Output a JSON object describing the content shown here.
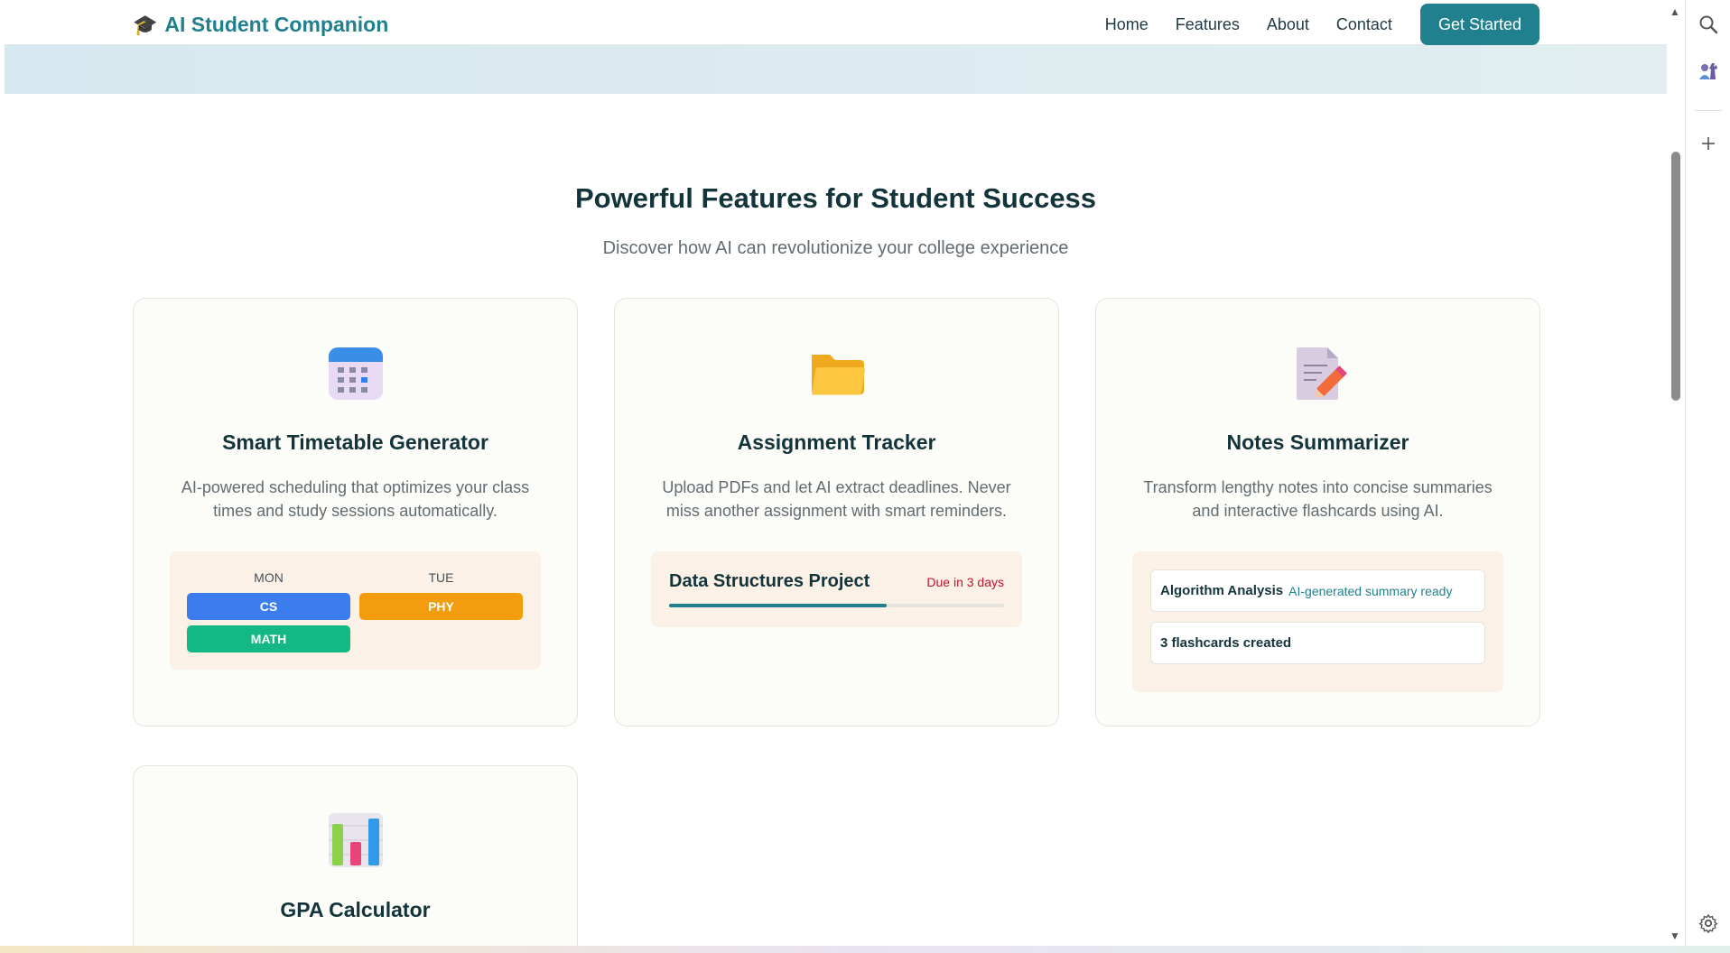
{
  "brand": {
    "icon": "🎓",
    "name": "AI Student Companion"
  },
  "nav": {
    "links": [
      "Home",
      "Features",
      "About",
      "Contact"
    ],
    "cta": "Get Started"
  },
  "section": {
    "title": "Powerful Features for Student Success",
    "subtitle": "Discover how AI can revolutionize your college experience"
  },
  "cards": [
    {
      "icon": "📅",
      "title": "Smart Timetable Generator",
      "desc": "AI-powered scheduling that optimizes your class times and study sessions automatically.",
      "timetable": {
        "days": [
          "MON",
          "TUE"
        ],
        "classes": [
          {
            "label": "CS",
            "color": "#3b7ded"
          },
          {
            "label": "PHY",
            "color": "#f39c0e"
          },
          {
            "label": "MATH",
            "color": "#14b883"
          }
        ]
      }
    },
    {
      "icon": "📂",
      "title": "Assignment Tracker",
      "desc": "Upload PDFs and let AI extract deadlines. Never miss another assignment with smart reminders.",
      "assignment": {
        "name": "Data Structures Project",
        "due": "Due in 3 days",
        "progress": 0.65
      }
    },
    {
      "icon": "📝",
      "title": "Notes Summarizer",
      "desc": "Transform lengthy notes into concise summaries and interactive flashcards using AI.",
      "notes": {
        "title": "Algorithm Analysis",
        "badge": "AI-generated summary ready",
        "count": "3 flashcards created"
      }
    },
    {
      "icon": "📊",
      "title": "GPA Calculator"
    }
  ],
  "colors": {
    "primary": "#21808d",
    "danger": "#c0152f",
    "card_bg": "#fcfcf9",
    "demo_bg": "#fbf1e6"
  },
  "chrome_icons": [
    "search-icon",
    "chess-icon",
    "plus-icon",
    "settings-icon"
  ]
}
